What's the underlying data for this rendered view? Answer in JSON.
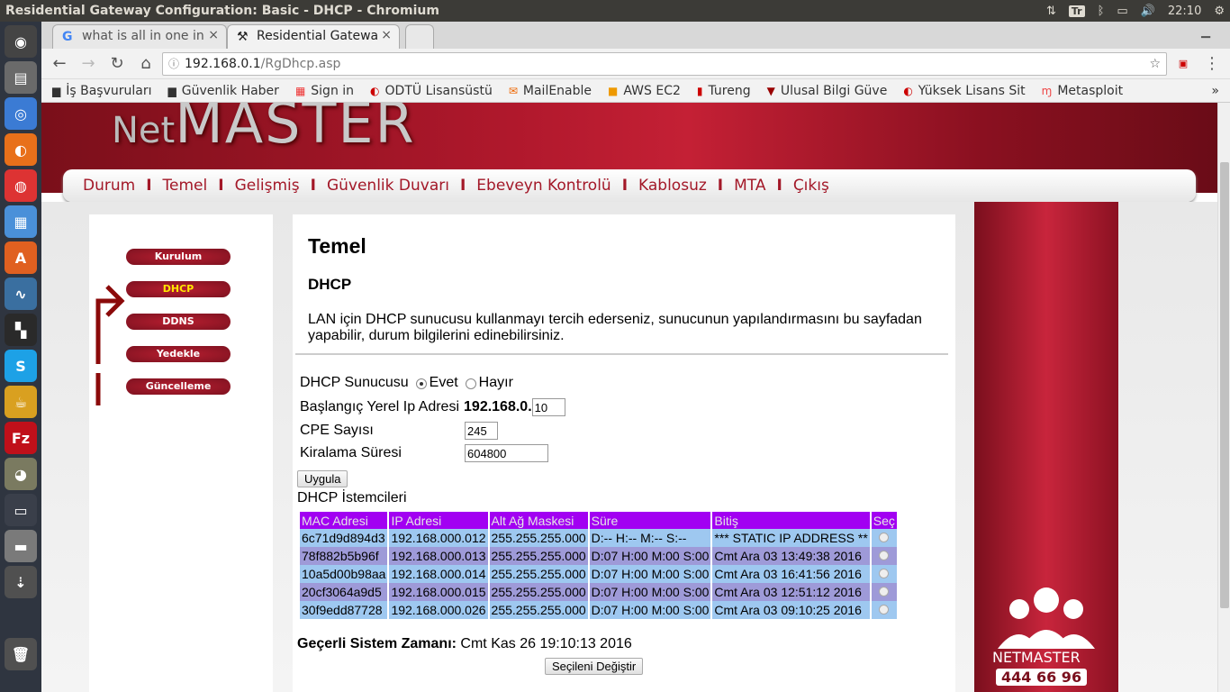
{
  "window": {
    "title": "Residential Gateway Configuration: Basic - DHCP - Chromium"
  },
  "tray": {
    "keyboard": "Tr",
    "clock": "22:10"
  },
  "tabs": [
    {
      "label": "what is all in one in",
      "icon": "google-icon"
    },
    {
      "label": "Residential Gatewa",
      "icon": "tools-icon"
    }
  ],
  "address": {
    "host": "192.168.0.1",
    "path": "/RgDhcp.asp"
  },
  "bookmarks": [
    "İş Başvuruları",
    "Güvenlik Haber",
    "Sign in",
    "ODTÜ Lisansüstü",
    "MailEnable",
    "AWS EC2",
    "Tureng",
    "Ulusal Bilgi Güve",
    "Yüksek Lisans Sit",
    "Metasploit"
  ],
  "logo": {
    "prefix": "Net",
    "main": "MASTER"
  },
  "nav": [
    "Durum",
    "Temel",
    "Gelişmiş",
    "Güvenlik Duvarı",
    "Ebeveyn Kontrolü",
    "Kablosuz",
    "MTA",
    "Çıkış"
  ],
  "sidebar": [
    "Kurulum",
    "DHCP",
    "DDNS",
    "Yedekle",
    "Güncelleme"
  ],
  "page": {
    "title": "Temel",
    "subtitle": "DHCP",
    "description": "LAN için DHCP sunucusu kullanmayı tercih ederseniz, sunucunun yapılandırmasını bu sayfadan yapabilir, durum bilgilerini edinebilirsiniz."
  },
  "form": {
    "server_label": "DHCP Sunucusu",
    "yes": "Evet",
    "no": "Hayır",
    "start_label": "Başlangıç Yerel Ip Adresi",
    "start_prefix": "192.168.0.",
    "start_value": "10",
    "cpe_label": "CPE Sayısı",
    "cpe_value": "245",
    "lease_label": "Kiralama Süresi",
    "lease_value": "604800",
    "apply": "Uygula"
  },
  "clients": {
    "title": "DHCP İstemcileri",
    "headers": [
      "MAC Adresi",
      "IP Adresi",
      "Alt Ağ Maskesi",
      "Süre",
      "Bitiş",
      "Seç"
    ],
    "rows": [
      [
        "6c71d9d894d3",
        "192.168.000.012",
        "255.255.255.000",
        "D:-- H:-- M:-- S:--",
        "*** STATIC IP ADDRESS **"
      ],
      [
        "78f882b5b96f",
        "192.168.000.013",
        "255.255.255.000",
        "D:07 H:00 M:00 S:00",
        "Cmt Ara 03 13:49:38 2016"
      ],
      [
        "10a5d00b98aa",
        "192.168.000.014",
        "255.255.255.000",
        "D:07 H:00 M:00 S:00",
        "Cmt Ara 03 16:41:56 2016"
      ],
      [
        "20cf3064a9d5",
        "192.168.000.015",
        "255.255.255.000",
        "D:07 H:00 M:00 S:00",
        "Cmt Ara 03 12:51:12 2016"
      ],
      [
        "30f9edd87728",
        "192.168.000.026",
        "255.255.255.000",
        "D:07 H:00 M:00 S:00",
        "Cmt Ara 03 09:10:25 2016"
      ]
    ]
  },
  "system_time": {
    "label": "Geçerli Sistem Zamanı:",
    "value": "Cmt Kas 26 19:10:13 2016"
  },
  "change_button": "Seçileni Değiştir",
  "right_panel": {
    "brand": "NETMASTER",
    "phone": "444 66 96"
  }
}
